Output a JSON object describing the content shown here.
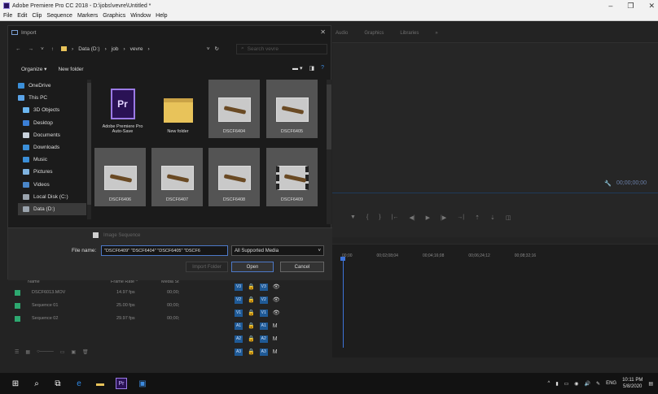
{
  "app": {
    "title": "Adobe Premiere Pro CC 2018 - D:\\jobs\\vevre\\Untitled *",
    "window_controls": [
      "–",
      "❐",
      "✕"
    ]
  },
  "menubar": [
    "File",
    "Edit",
    "Clip",
    "Sequence",
    "Markers",
    "Graphics",
    "Window",
    "Help"
  ],
  "premiere": {
    "workspace_tabs": [
      "Audio",
      "Graphics",
      "Libraries",
      "»"
    ],
    "timecode": "00;00;00;00",
    "ruler": [
      "00;00",
      "00;02;08;04",
      "00;04;16;08",
      "00;06;24;12",
      "00;08;32;16"
    ],
    "tracks": [
      {
        "src": "V3",
        "dst": "V3"
      },
      {
        "src": "V2",
        "dst": "V2"
      },
      {
        "src": "V1",
        "dst": "V1"
      },
      {
        "src": "A1",
        "dst": "A1"
      },
      {
        "src": "A2",
        "dst": "A2"
      },
      {
        "src": "A3",
        "dst": "A3"
      }
    ],
    "project_columns": [
      "Name",
      "Frame Rate ^",
      "Media St"
    ],
    "project_items": [
      {
        "name": "DSCF6013.MOV",
        "rate": "14.97 fps",
        "start": "00;00;"
      },
      {
        "name": "Sequence 01",
        "rate": "25.00 fps",
        "start": "00;00;"
      },
      {
        "name": "Sequence 02",
        "rate": "29.97 fps",
        "start": "00;00;"
      }
    ]
  },
  "dialog": {
    "title": "Import",
    "path": [
      "Data (D:)",
      "job",
      "vevre"
    ],
    "search_placeholder": "Search vevre",
    "organize": "Organize ▾",
    "new_folder": "New folder",
    "nav": [
      {
        "label": "OneDrive",
        "icon": "cloud-icon",
        "color": "#3b8fd9"
      },
      {
        "label": "This PC",
        "icon": "computer-icon",
        "color": "#5aa3e8"
      },
      {
        "label": "3D Objects",
        "icon": "cube-icon",
        "color": "#6bb6f0"
      },
      {
        "label": "Desktop",
        "icon": "desktop-icon",
        "color": "#3b7fd6"
      },
      {
        "label": "Documents",
        "icon": "document-icon",
        "color": "#c9d2dc"
      },
      {
        "label": "Downloads",
        "icon": "download-icon",
        "color": "#3b8fd9"
      },
      {
        "label": "Music",
        "icon": "music-icon",
        "color": "#3b8fd9"
      },
      {
        "label": "Pictures",
        "icon": "picture-icon",
        "color": "#7fb3e0"
      },
      {
        "label": "Videos",
        "icon": "video-icon",
        "color": "#4a86c9"
      },
      {
        "label": "Local Disk (C:)",
        "icon": "drive-icon",
        "color": "#9aa3ad"
      },
      {
        "label": "Data (D:)",
        "icon": "drive-icon",
        "color": "#9aa3ad"
      }
    ],
    "files": [
      {
        "label": "Adobe Premiere Pro Auto-Save",
        "kind": "prproj"
      },
      {
        "label": "New folder",
        "kind": "folder"
      },
      {
        "label": "DSCF6404",
        "kind": "image"
      },
      {
        "label": "DSCF6405",
        "kind": "image"
      },
      {
        "label": "DSCF6406",
        "kind": "image"
      },
      {
        "label": "DSCF6407",
        "kind": "image"
      },
      {
        "label": "DSCF6408",
        "kind": "image"
      },
      {
        "label": "DSCF6409",
        "kind": "video"
      }
    ],
    "image_sequence": "Image Sequence",
    "file_name_label": "File name:",
    "file_name_value": "\"DSCF6409\" \"DSCF6404\" \"DSCF6405\" \"DSCF6",
    "file_type": "All Supported Media",
    "import_folder": "Import Folder",
    "open": "Open",
    "cancel": "Cancel"
  },
  "taskbar": {
    "lang": "ENG",
    "time": "10:11 PM",
    "date": "5/8/2020"
  }
}
